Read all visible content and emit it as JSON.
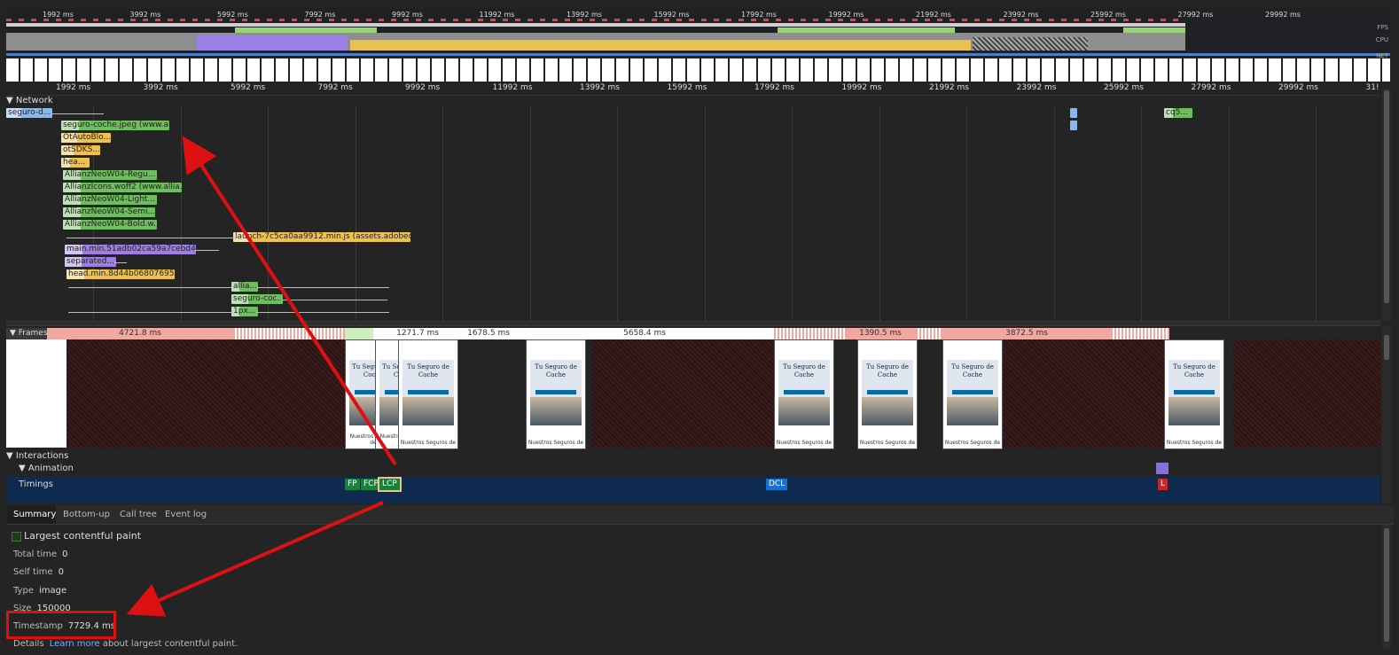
{
  "overview": {
    "ticks": [
      "1992 ms",
      "3992 ms",
      "5992 ms",
      "7992 ms",
      "9992 ms",
      "11992 ms",
      "13992 ms",
      "15992 ms",
      "17992 ms",
      "19992 ms",
      "21992 ms",
      "23992 ms",
      "25992 ms",
      "27992 ms",
      "29992 ms"
    ],
    "lanes": {
      "fps": "FPS",
      "cpu": "CPU",
      "net": "NET"
    }
  },
  "ruler": {
    "ticks": [
      "1992 ms",
      "3992 ms",
      "5992 ms",
      "7992 ms",
      "9992 ms",
      "11992 ms",
      "13992 ms",
      "15992 ms",
      "17992 ms",
      "19992 ms",
      "21992 ms",
      "23992 ms",
      "25992 ms",
      "27992 ms",
      "29992 ms",
      "31!"
    ]
  },
  "network": {
    "header": "▼ Network",
    "requests": [
      {
        "label": "seguro-d...",
        "color": "blue"
      },
      {
        "label": "seguro-coche.jpeg (www.all...",
        "color": "green"
      },
      {
        "label": "OtAutoBlo...",
        "color": "yellow"
      },
      {
        "label": "otSDKS...",
        "color": "yellow"
      },
      {
        "label": "hea...",
        "color": "yellow"
      },
      {
        "label": "AllianzNeoW04-Regu...",
        "color": "green"
      },
      {
        "label": "AllianzIcons.woff2 (www.allia...",
        "color": "green"
      },
      {
        "label": "AllianzNeoW04-Light...",
        "color": "green"
      },
      {
        "label": "AllianzNeoW04-Semi...",
        "color": "green"
      },
      {
        "label": "AllianzNeoW04-Bold.w...",
        "color": "green"
      },
      {
        "label": "launch-7c5ca0aa9912.min.js (assets.adobedtm...",
        "color": "yellow"
      },
      {
        "label": "main.min.51adb02ca59a7cebd4c4...",
        "color": "purple"
      },
      {
        "label": "separated...",
        "color": "purple"
      },
      {
        "label": "head.min.8d44b068076957...",
        "color": "yellow"
      },
      {
        "label": "allia...",
        "color": "green"
      },
      {
        "label": "seguro-coc...",
        "color": "green"
      },
      {
        "label": "1px...",
        "color": "green"
      },
      {
        "label": "cq5...",
        "color": "green"
      }
    ]
  },
  "frames": {
    "header": "▼ Frames",
    "durations": [
      "4721.8 ms",
      "1271.7 ms",
      "1678.5 ms",
      "5658.4 ms",
      "1390.5 ms",
      "3872.5 ms"
    ],
    "screenshot_title": "Tu Seguro de Coche",
    "screenshot_footer": "Nuestros Seguros de"
  },
  "interactions": {
    "label": "▼ Interactions"
  },
  "animation": {
    "label": "▼ Animation"
  },
  "timings": {
    "label": "Timings",
    "markers": [
      {
        "text": "FP",
        "color": "#1a7f37"
      },
      {
        "text": "FCP",
        "color": "#1a7f37"
      },
      {
        "text": "LCP",
        "color": "#1a7f37"
      },
      {
        "text": "DCL",
        "color": "#1a6fd1"
      },
      {
        "text": "L",
        "color": "#c62828"
      }
    ]
  },
  "tabs": [
    "Summary",
    "Bottom-up",
    "Call tree",
    "Event log"
  ],
  "summary": {
    "title": "Largest contentful paint",
    "total_time_label": "Total time",
    "total_time": "0",
    "self_time_label": "Self time",
    "self_time": "0",
    "type_label": "Type",
    "type": "image",
    "size_label": "Size",
    "size": "150000",
    "timestamp_label": "Timestamp",
    "timestamp": "7729.4 ms",
    "details_label": "Details",
    "details_link": "Learn more",
    "details_rest": "about largest contentful paint."
  },
  "colors": {
    "annotation": "#dd1111",
    "lcp_border": "#f5b7a0"
  }
}
